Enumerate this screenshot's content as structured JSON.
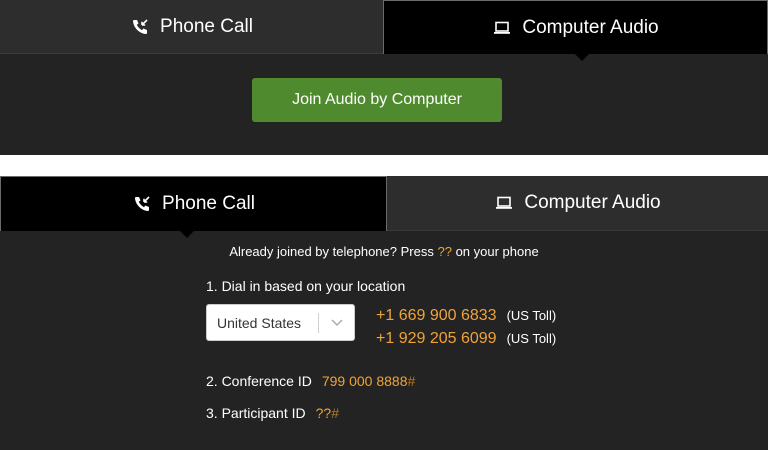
{
  "panel_top": {
    "tabs": {
      "phone_label": "Phone Call",
      "computer_label": "Computer Audio",
      "active": "computer"
    },
    "join_button_label": "Join Audio by Computer"
  },
  "panel_bottom": {
    "tabs": {
      "phone_label": "Phone Call",
      "computer_label": "Computer Audio",
      "active": "phone"
    },
    "already_joined": {
      "prefix": "Already joined by telephone? Press",
      "code": "??",
      "suffix": "on your phone"
    },
    "dial_title": "1. Dial in based on your location",
    "country_select": {
      "selected": "United States"
    },
    "numbers": [
      {
        "number": "+1 669 900 6833",
        "type": "(US Toll)"
      },
      {
        "number": "+1 929 205 6099",
        "type": "(US Toll)"
      }
    ],
    "conference": {
      "label": "2. Conference ID",
      "value": "799 000 8888",
      "hash": "#"
    },
    "participant": {
      "label": "3. Participant ID",
      "value": "??",
      "hash": "#"
    }
  },
  "colors": {
    "panel_bg": "#232323",
    "active_tab_bg": "#000000",
    "button_green": "#4f8b2e",
    "accent_orange": "#f0a33a"
  },
  "icons": {
    "phone": "phone-incoming-icon",
    "computer": "laptop-icon",
    "select_arrow": "chevron-down-icon"
  }
}
